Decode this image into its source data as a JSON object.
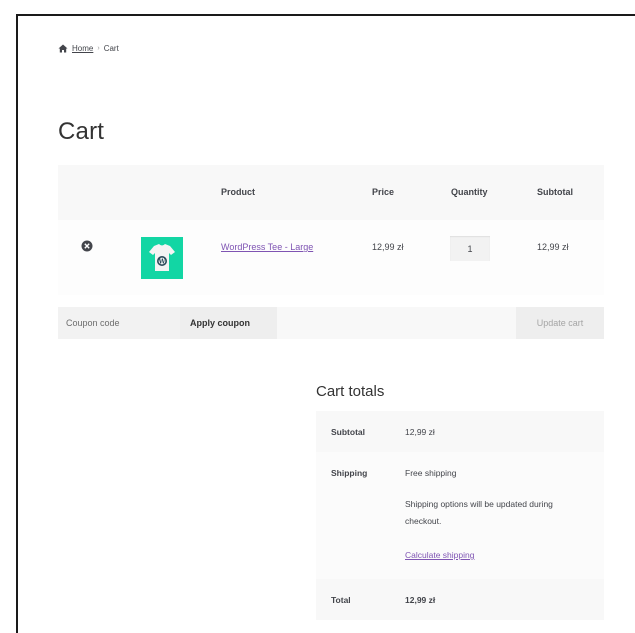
{
  "breadcrumb": {
    "home_label": "Home",
    "separator": "›",
    "current": "Cart"
  },
  "page": {
    "title": "Cart"
  },
  "cart_table": {
    "headers": {
      "product": "Product",
      "price": "Price",
      "quantity": "Quantity",
      "subtotal": "Subtotal"
    },
    "rows": [
      {
        "product_name": "WordPress Tee - Large",
        "price": "12,99 zł",
        "quantity": "1",
        "subtotal": "12,99 zł"
      }
    ]
  },
  "actions": {
    "coupon_placeholder": "Coupon code",
    "apply_coupon_label": "Apply coupon",
    "update_cart_label": "Update cart"
  },
  "totals": {
    "title": "Cart totals",
    "subtotal_label": "Subtotal",
    "subtotal_value": "12,99 zł",
    "shipping_label": "Shipping",
    "shipping_value": "Free shipping",
    "shipping_note": "Shipping options will be updated during checkout.",
    "calculate_shipping_label": "Calculate shipping",
    "total_label": "Total",
    "total_value": "12,99 zł"
  },
  "icons": {
    "home": "home-icon",
    "remove": "remove-item-icon",
    "thumbnail": "tshirt-thumbnail"
  },
  "colors": {
    "link": "#7f54b3",
    "thumbnail_bg": "#12d6a4",
    "text": "#43454b"
  }
}
